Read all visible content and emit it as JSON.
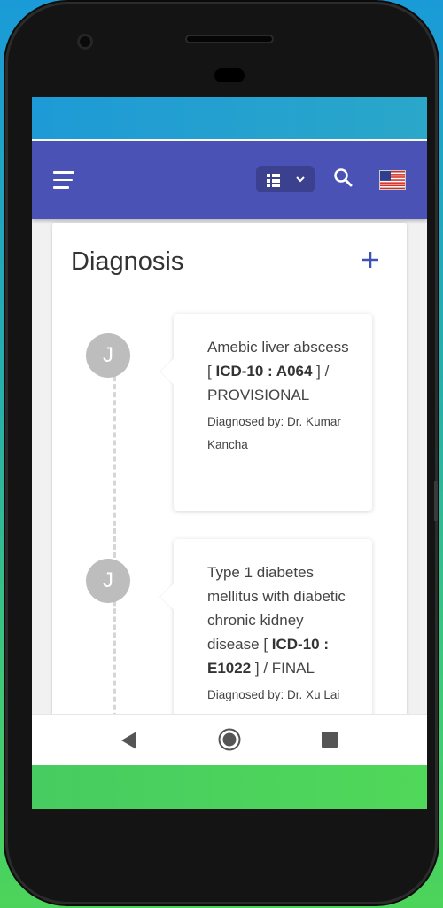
{
  "header": {
    "apps_menu_icon": "grid-icon",
    "search_icon": "search-icon",
    "language_flag": "us-flag-icon"
  },
  "diagnosis": {
    "title": "Diagnosis",
    "add_icon": "plus-icon",
    "entries": [
      {
        "avatar_initial": "J",
        "name": "Amebic liver abscess [",
        "code": "ICD-10 : A064",
        "status": "] / PROVISIONAL",
        "diagnosed_by": "Diagnosed by: Dr. Kumar Kancha"
      },
      {
        "avatar_initial": "J",
        "name": "Type 1 diabetes mellitus with diabetic chronic kidney disease [",
        "code": "ICD-10 : E1022",
        "status": "] / FINAL",
        "diagnosed_by": "Diagnosed by: Dr. Xu Lai"
      }
    ]
  },
  "navigation": {
    "back_icon": "back-triangle-icon",
    "home_icon": "home-circle-icon",
    "recents_icon": "recents-square-icon"
  },
  "colors": {
    "app_bar": "#4a52b5",
    "accent": "#3f51b5"
  }
}
